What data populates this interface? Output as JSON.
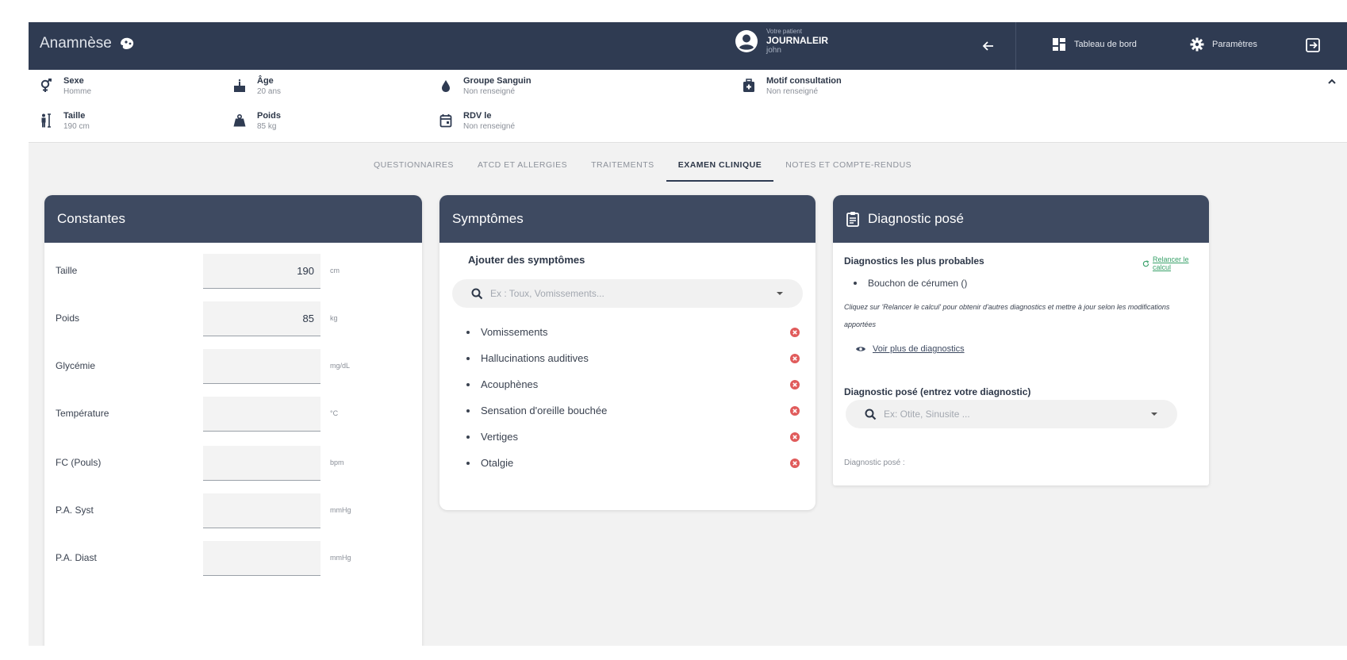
{
  "header": {
    "app_name": "Anamnèse",
    "patient_label": "Votre patient",
    "patient_name": "JOURNALEIR",
    "patient_firstname": "john",
    "dashboard_label": "Tableau de bord",
    "settings_label": "Paramètres"
  },
  "info": {
    "sexe_label": "Sexe",
    "sexe_value": "Homme",
    "age_label": "Âge",
    "age_value": "20 ans",
    "blood_label": "Groupe Sanguin",
    "blood_value": "Non renseigné",
    "motif_label": "Motif consultation",
    "motif_value": "Non renseigné",
    "taille_label": "Taille",
    "taille_value": "190 cm",
    "poids_label": "Poids",
    "poids_value": "85 kg",
    "rdv_label": "RDV le",
    "rdv_value": "Non renseigné"
  },
  "tabs": [
    {
      "label": "QUESTIONNAIRES"
    },
    {
      "label": "ATCD ET ALLERGIES"
    },
    {
      "label": "TRAITEMENTS"
    },
    {
      "label": "EXAMEN CLINIQUE"
    },
    {
      "label": "NOTES ET COMPTE-RENDUS"
    }
  ],
  "constantes": {
    "title": "Constantes",
    "rows": [
      {
        "label": "Taille",
        "value": "190",
        "unit": "cm"
      },
      {
        "label": "Poids",
        "value": "85",
        "unit": "kg"
      },
      {
        "label": "Glycémie",
        "value": "",
        "unit": "mg/dL"
      },
      {
        "label": "Température",
        "value": "",
        "unit": "°C"
      },
      {
        "label": "FC (Pouls)",
        "value": "",
        "unit": "bpm"
      },
      {
        "label": "P.A. Syst",
        "value": "",
        "unit": "mmHg"
      },
      {
        "label": "P.A. Diast",
        "value": "",
        "unit": "mmHg"
      }
    ]
  },
  "symptomes": {
    "title": "Symptômes",
    "add_label": "Ajouter des symptômes",
    "search_placeholder": "Ex : Toux, Vomissements...",
    "items": [
      "Vomissements",
      "Hallucinations auditives",
      "Acouphènes",
      "Sensation d'oreille bouchée",
      "Vertiges",
      "Otalgie"
    ]
  },
  "diagnostic": {
    "title": "Diagnostic posé",
    "probable_title": "Diagnostics les plus probables",
    "recalc_label": "Relancer le calcul",
    "probable_item": "Bouchon de cérumen ()",
    "note": "Cliquez sur 'Relancer le calcul' pour obtenir d'autres diagnostics et mettre à jour selon les modifications apportées",
    "more_label": "Voir plus de diagnostics",
    "enter_label": "Diagnostic posé (entrez votre diagnostic)",
    "search_placeholder": "Ex: Otite, Sinusite ...",
    "result_label": "Diagnostic posé :"
  },
  "colors": {
    "header_bg": "#2f3b52",
    "card_head_bg": "#3e4a61",
    "remove_red": "#e05b5b",
    "recalc_green": "#38a169"
  }
}
